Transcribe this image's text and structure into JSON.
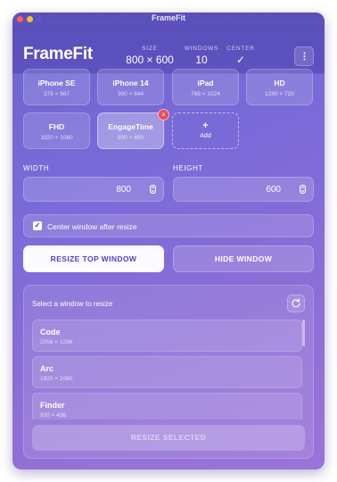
{
  "window": {
    "title": "FrameFit",
    "traffic_colors": [
      "#ff5f57",
      "#febc2e",
      "#28c840"
    ]
  },
  "header": {
    "brand": "FrameFit",
    "stats": {
      "size": {
        "label": "SIZE",
        "value": "800 × 600"
      },
      "windows": {
        "label": "WINDOWS",
        "value": "10"
      },
      "center": {
        "label": "CENTER",
        "value": "✓"
      }
    },
    "menu_icon": "more-vertical-icon"
  },
  "presets": [
    {
      "name": "iPhone SE",
      "dims": "375 × 667"
    },
    {
      "name": "iPhone 14",
      "dims": "390 × 844"
    },
    {
      "name": "iPad",
      "dims": "768 × 1024"
    },
    {
      "name": "HD",
      "dims": "1280 × 720"
    },
    {
      "name": "FHD",
      "dims": "1920 × 1080"
    },
    {
      "name": "EngageTime",
      "dims": "800 × 600",
      "active": true,
      "removable": true
    }
  ],
  "add_preset": {
    "plus": "+",
    "label": "Add"
  },
  "size_fields": {
    "width": {
      "label": "WIDTH",
      "value": "800"
    },
    "height": {
      "label": "HEIGHT",
      "value": "600"
    }
  },
  "center_option": {
    "label": "Center window after resize",
    "checked": true
  },
  "actions": {
    "resize_top": "RESIZE TOP WINDOW",
    "hide_window": "HIDE WINDOW"
  },
  "window_list": {
    "title": "Select a window to resize",
    "items": [
      {
        "name": "Code",
        "dims": "2056 × 1286"
      },
      {
        "name": "Arc",
        "dims": "1920 × 1080"
      },
      {
        "name": "Finder",
        "dims": "920 × 436"
      }
    ],
    "resize_selected": "RESIZE SELECTED"
  }
}
